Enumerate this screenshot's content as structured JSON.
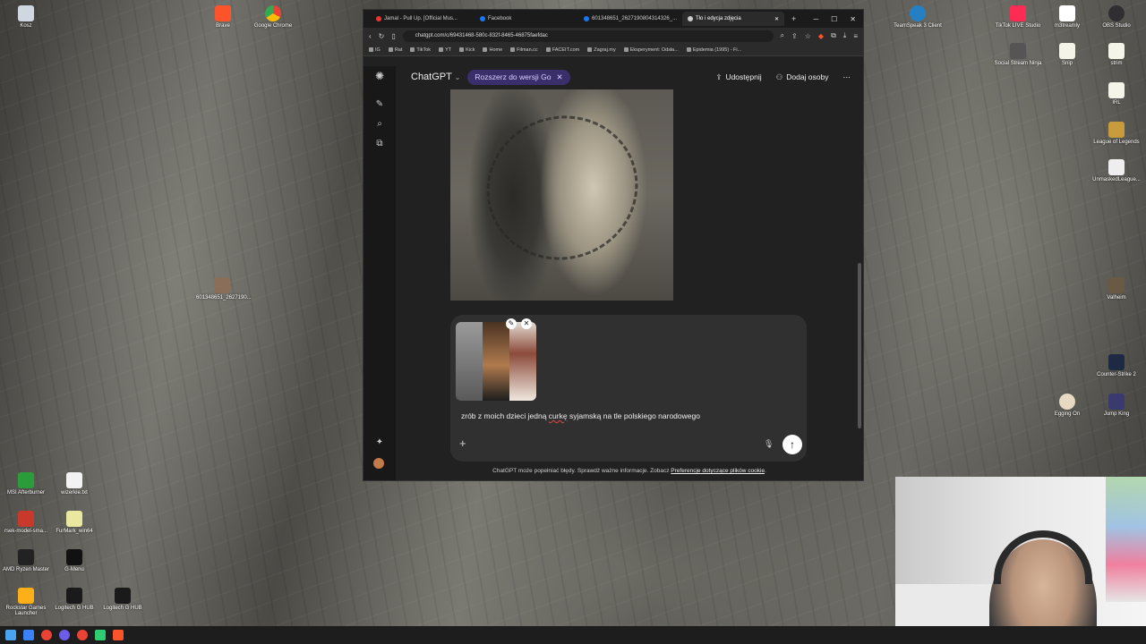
{
  "desktop": {
    "icons_left": [
      {
        "label": "Kosz"
      },
      {
        "label": "Brave"
      },
      {
        "label": "Google Chrome"
      },
      {
        "label": "601348651_2627190..."
      },
      {
        "label": "MSI Afterburner"
      },
      {
        "label": "wizerkie.txt"
      },
      {
        "label": "rsek-model-sma..."
      },
      {
        "label": "FurMark_win64"
      },
      {
        "label": "AMD Ryzen Master"
      },
      {
        "label": "G-Menu"
      },
      {
        "label": "Rockstar Games Launcher"
      },
      {
        "label": "Logitech G HUB"
      },
      {
        "label": "Logitech G HUB"
      }
    ],
    "icons_right": [
      {
        "label": "TeamSpeak 3 Client"
      },
      {
        "label": "TikTok LIVE Studio"
      },
      {
        "label": "m3treamly"
      },
      {
        "label": "OBS Studio"
      },
      {
        "label": "Social Stream Ninja"
      },
      {
        "label": "Snip"
      },
      {
        "label": "strim"
      },
      {
        "label": "IRL"
      },
      {
        "label": "League of Legends"
      },
      {
        "label": "UnmaskedLeague..."
      },
      {
        "label": "Valheim"
      },
      {
        "label": "Counter-Strike 2"
      },
      {
        "label": "Egging On"
      },
      {
        "label": "Jump King"
      }
    ]
  },
  "browser": {
    "tabs": [
      {
        "label": "Jamal - Pull Up. [Official Mus..."
      },
      {
        "label": "Facebook"
      },
      {
        "label": "601348651_2627190804314326_..."
      },
      {
        "label": "Tło i edycja zdjęcia"
      }
    ],
    "url": "chatgpt.com/c/69431468-580c-832f-8465-46875faefdac",
    "bookmarks": [
      "IG",
      "Rat",
      "TikTok",
      "YT",
      "Kick",
      "Home",
      "Filman.cc",
      "FACEIT.com",
      "Zagraj.my",
      "Eksperyment: Odsła...",
      "Epidemia (1995) - Fi..."
    ]
  },
  "chatgpt": {
    "model": "ChatGPT",
    "upgrade_label": "Rozszerz do wersji Go",
    "share_label": "Udostępnij",
    "add_people_label": "Dodaj osoby",
    "prompt_before": "zrób z moich dzieci jedną ",
    "prompt_misspelled": "curkę",
    "prompt_after": " syjamską na tle polskiego narodowego",
    "disclaimer_text": "ChatGPT może popełniać błędy. Sprawdź ważne informacje. Zobacz ",
    "disclaimer_link": "Preferencje dotyczące plików cookie",
    "disclaimer_end": "."
  },
  "colors": {
    "app_bg": "#212121",
    "composer_bg": "#303030",
    "upgrade_pill": "#3b2f6b"
  }
}
